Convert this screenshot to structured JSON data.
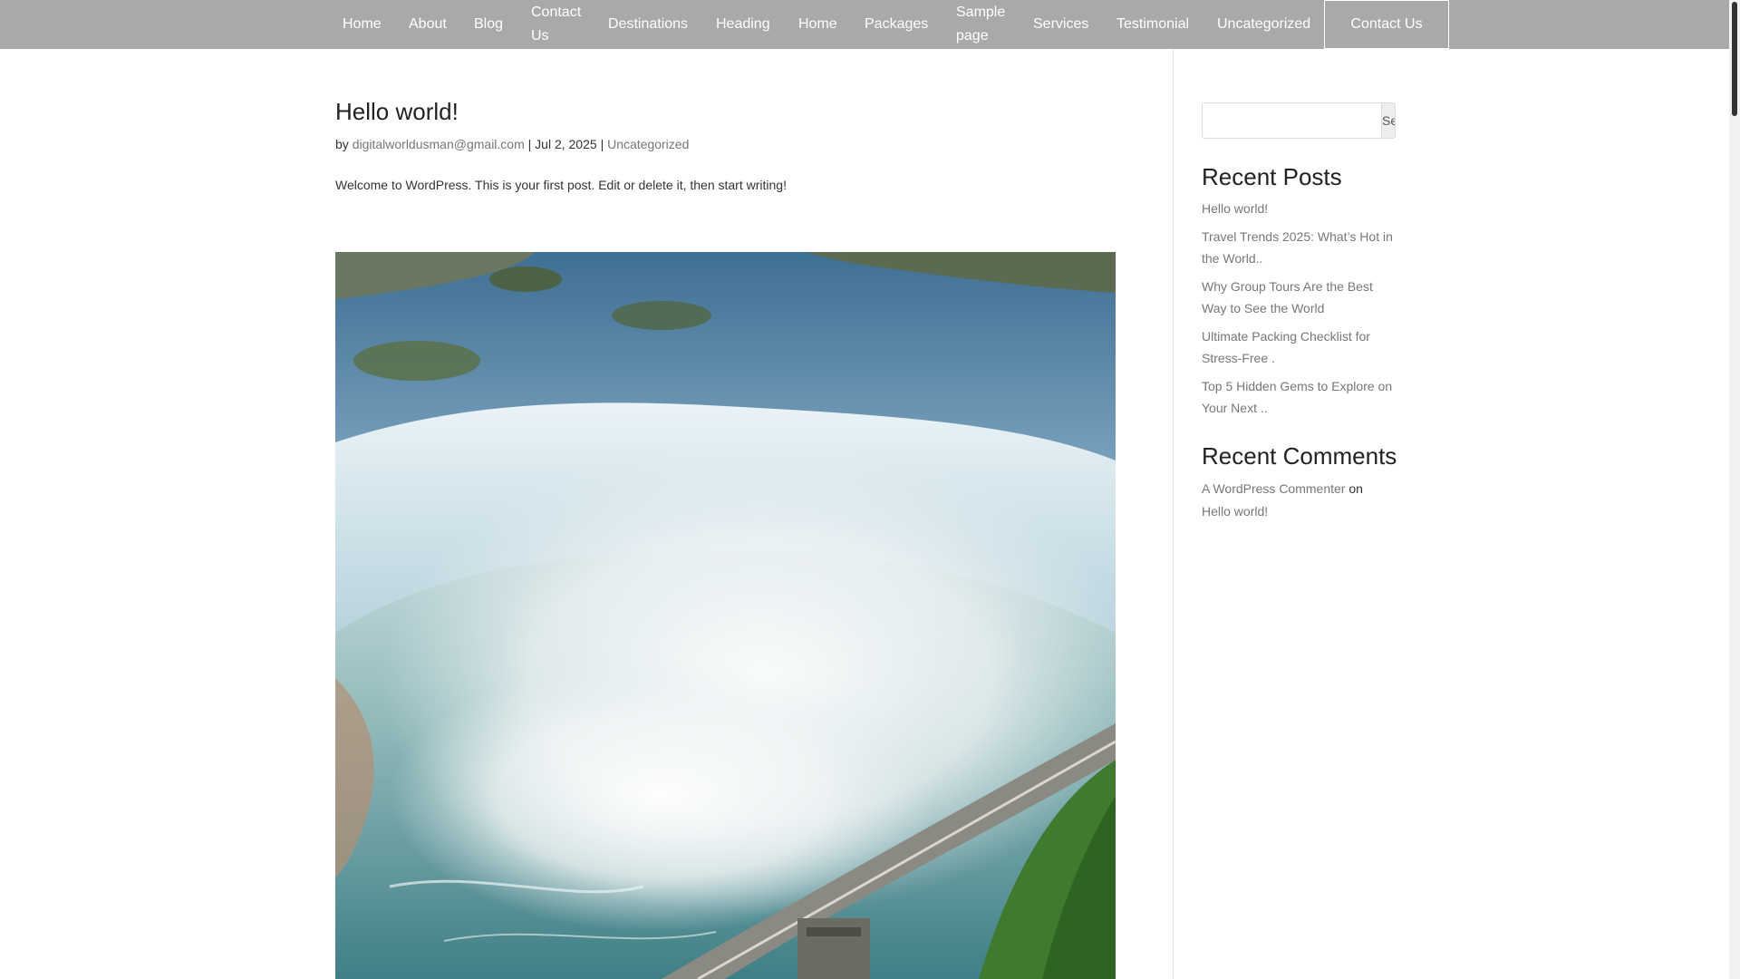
{
  "nav": {
    "items": [
      "Home",
      "About",
      "Blog",
      "Contact Us",
      "Destinations",
      "Heading",
      "Home",
      "Packages",
      "Sample page",
      "Services",
      "Testimonial",
      "Uncategorized"
    ],
    "cta_label": "Contact Us"
  },
  "post": {
    "title": "Hello world!",
    "meta_by": "by",
    "author": "digitalworldusman@gmail.com",
    "sep1": "|",
    "date": "Jul 2, 2025",
    "sep2": "|",
    "category": "Uncategorized",
    "body": "Welcome to WordPress. This is your first post. Edit or delete it, then start writing!"
  },
  "sidebar": {
    "search_placeholder": "",
    "search_button": "Search",
    "recent_posts_title": "Recent Posts",
    "recent_posts": [
      "Hello world!",
      "Travel Trends 2025: What’s Hot in the World..",
      "Why Group Tours Are the Best Way to See the World",
      "Ultimate Packing Checklist for Stress-Free .",
      "Top 5 Hidden Gems to Explore on Your Next .."
    ],
    "recent_comments_title": "Recent Comments",
    "comment": {
      "author": "A WordPress Commenter",
      "on": "on",
      "post": "Hello world!"
    }
  },
  "colors": {
    "nav_bg": "#a9a9a9",
    "nav_text": "#ffffff",
    "link": "#777777"
  }
}
